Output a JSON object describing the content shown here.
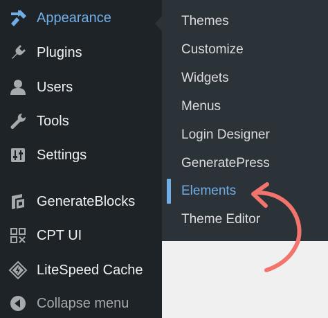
{
  "sidebar": {
    "items": [
      {
        "label": "Appearance",
        "icon": "paint-brush-icon"
      },
      {
        "label": "Plugins",
        "icon": "plugin-icon"
      },
      {
        "label": "Users",
        "icon": "user-icon"
      },
      {
        "label": "Tools",
        "icon": "wrench-icon"
      },
      {
        "label": "Settings",
        "icon": "settings-sliders-icon"
      },
      {
        "label": "GenerateBlocks",
        "icon": "generateblocks-icon"
      },
      {
        "label": "CPT UI",
        "icon": "cpt-ui-icon"
      },
      {
        "label": "LiteSpeed Cache",
        "icon": "litespeed-icon"
      }
    ],
    "collapse_label": "Collapse menu"
  },
  "submenu": {
    "items": [
      {
        "label": "Themes"
      },
      {
        "label": "Customize"
      },
      {
        "label": "Widgets"
      },
      {
        "label": "Menus"
      },
      {
        "label": "Login Designer"
      },
      {
        "label": "GeneratePress"
      },
      {
        "label": "Elements"
      },
      {
        "label": "Theme Editor"
      }
    ],
    "active_index": 6
  },
  "colors": {
    "sidebar_bg": "#1d2327",
    "submenu_bg": "#2c3338",
    "accent": "#72aee6",
    "annotation_arrow": "#f3736d"
  }
}
